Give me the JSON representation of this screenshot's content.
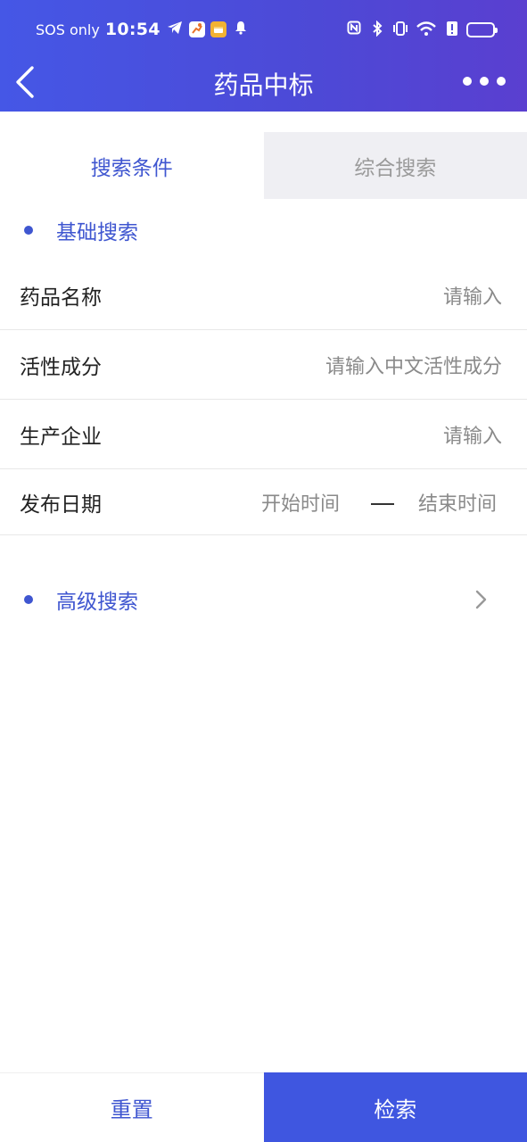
{
  "status_bar": {
    "carrier": "SOS only",
    "time": "10:54",
    "left_icons": [
      "telegram-icon",
      "app-runner-icon",
      "app-wallet-icon",
      "bell-icon"
    ],
    "right_icons": [
      "nfc-icon",
      "bluetooth-icon",
      "vibrate-icon",
      "wifi-icon",
      "alert-icon",
      "battery-icon"
    ],
    "wifi_label": "6"
  },
  "header": {
    "title": "药品中标",
    "back_icon": "chevron-left-icon",
    "more_icon": "more-dots-icon",
    "gradient_start": "#4557e6",
    "gradient_end": "#5a3fd0"
  },
  "tabs": [
    {
      "label": "搜索条件",
      "active": true
    },
    {
      "label": "综合搜索",
      "active": false
    }
  ],
  "basic_section": {
    "label": "基础搜索",
    "fields": [
      {
        "label": "药品名称",
        "placeholder": "请输入"
      },
      {
        "label": "活性成分",
        "placeholder": "请输入中文活性成分"
      },
      {
        "label": "生产企业",
        "placeholder": "请输入"
      }
    ],
    "date_field": {
      "label": "发布日期",
      "start_placeholder": "开始时间",
      "end_placeholder": "结束时间"
    }
  },
  "advanced_section": {
    "label": "高级搜索"
  },
  "footer": {
    "reset_label": "重置",
    "search_label": "检索"
  },
  "colors": {
    "accent": "#3f56d0",
    "search_button": "#3f56e0",
    "inactive_tab_bg": "#efeff3"
  }
}
